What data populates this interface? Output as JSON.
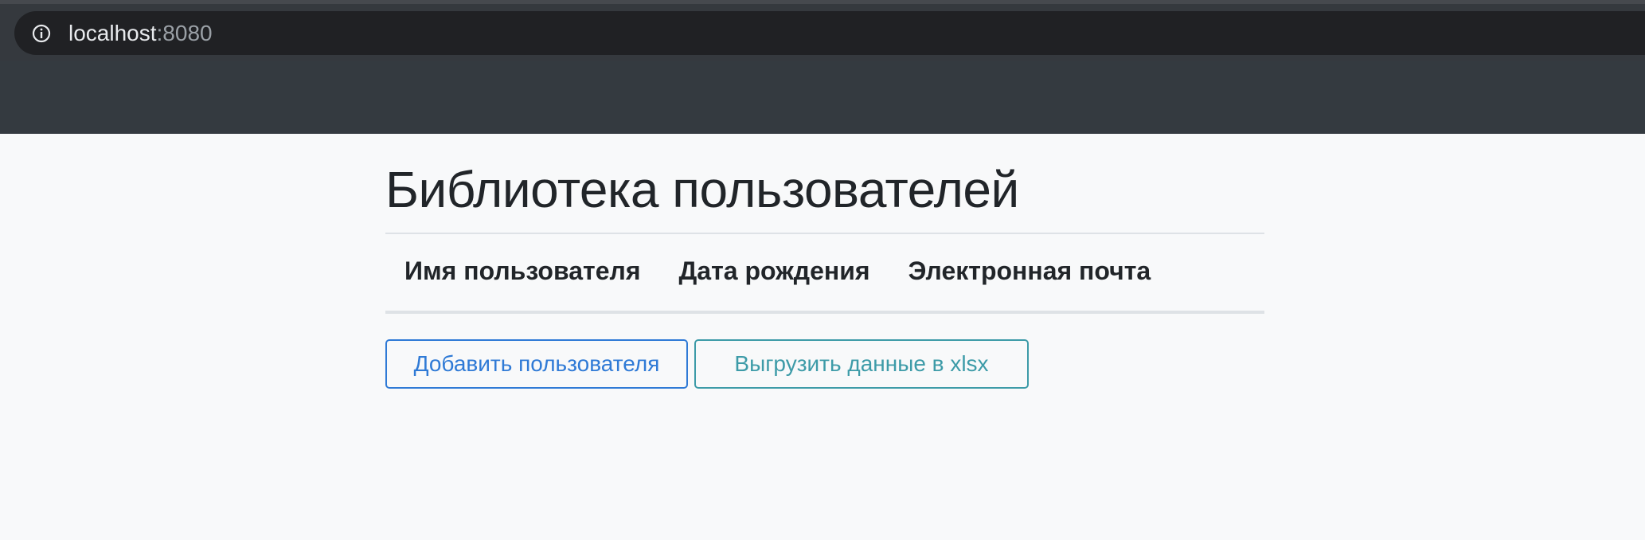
{
  "browser": {
    "host": "localhost",
    "port": ":8080",
    "info_icon": "info-circle-icon"
  },
  "page": {
    "title": "Библиотека пользователей"
  },
  "table": {
    "columns": [
      "Имя пользователя",
      "Дата рождения",
      "Электронная почта"
    ],
    "rows": []
  },
  "actions": {
    "add_user_label": "Добавить пользователя",
    "export_label": "Выгрузить данные в xlsx"
  },
  "colors": {
    "navbar": "#343a40",
    "primary": "#2f7ad6",
    "info": "#3d9ba8",
    "page_background": "#f8f9fa"
  }
}
